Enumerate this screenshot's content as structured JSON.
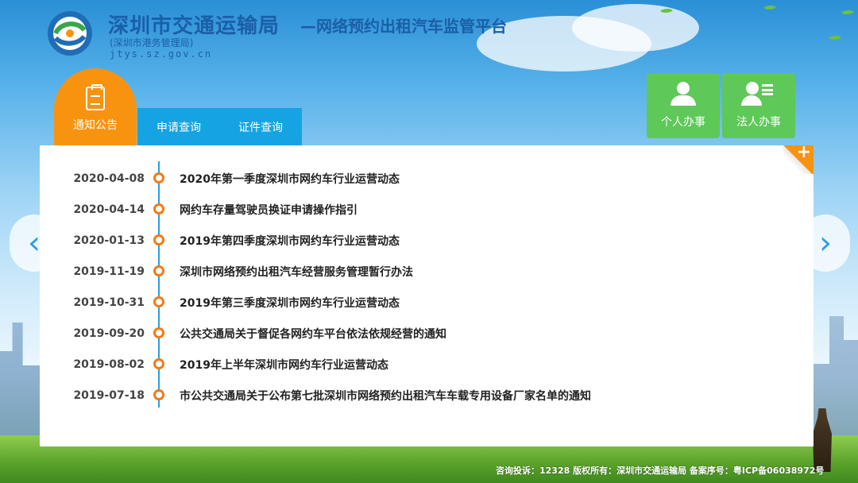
{
  "header": {
    "title": "深圳市交通运输局",
    "subtitle": "—网络预约出租汽车监管平台",
    "sub_org": "(深圳市港务管理局)",
    "url": "jtys.sz.gov.cn"
  },
  "tabs": [
    {
      "label": "通知公告",
      "active": true,
      "icon": "clipboard-icon"
    },
    {
      "label": "申请查询",
      "active": false
    },
    {
      "label": "证件查询",
      "active": false
    }
  ],
  "services": [
    {
      "label": "个人办事",
      "icon": "person-icon"
    },
    {
      "label": "法人办事",
      "icon": "business-person-icon"
    }
  ],
  "more_label": "+",
  "news": [
    {
      "date": "2020-04-08",
      "title": "2020年第一季度深圳市网约车行业运营动态"
    },
    {
      "date": "2020-04-14",
      "title": "网约车存量驾驶员换证申请操作指引"
    },
    {
      "date": "2020-01-13",
      "title": "2019年第四季度深圳市网约车行业运营动态"
    },
    {
      "date": "2019-11-19",
      "title": "深圳市网络预约出租汽车经营服务管理暂行办法"
    },
    {
      "date": "2019-10-31",
      "title": "2019年第三季度深圳市网约车行业运营动态"
    },
    {
      "date": "2019-09-20",
      "title": "公共交通局关于督促各网约车平台依法依规经营的通知"
    },
    {
      "date": "2019-08-02",
      "title": "2019年上半年深圳市网约车行业运营动态"
    },
    {
      "date": "2019-07-18",
      "title": "市公共交通局关于公布第七批深圳市网络预约出租汽车车载专用设备厂家名单的通知"
    }
  ],
  "nav": {
    "prev": "‹",
    "next": "›"
  },
  "footer": {
    "text": "咨询投诉：12328  版权所有：深圳市交通运输局 备案序号：粤ICP备06038972号"
  },
  "colors": {
    "accent_orange": "#f7930f",
    "tab_blue": "#16a3e3",
    "service_green": "#5ec858",
    "timeline_blue": "#2a9fe0",
    "dot_orange": "#f47a14"
  }
}
